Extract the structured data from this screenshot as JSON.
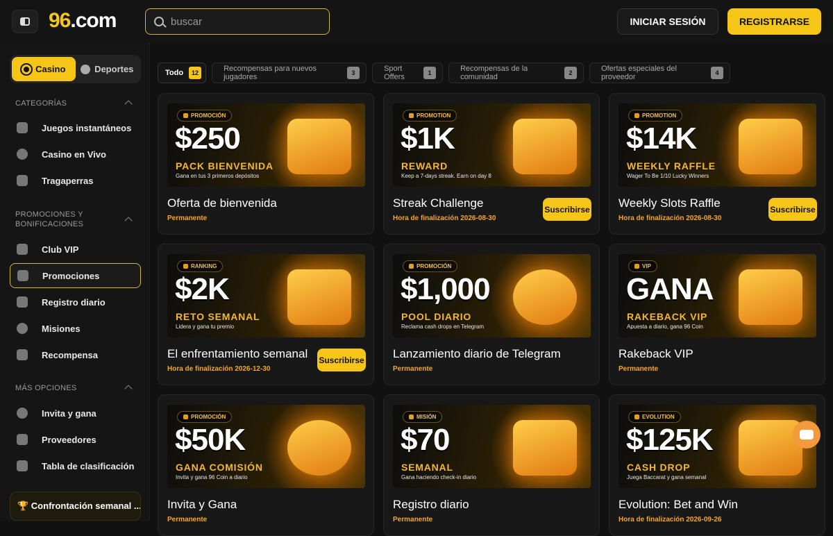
{
  "header": {
    "logo_num": "96",
    "logo_domain": ".com",
    "search_placeholder": "buscar",
    "login_label": "INICIAR SESIÓN",
    "register_label": "REGISTRARSE"
  },
  "sidebar": {
    "switch": {
      "casino": "Casino",
      "sports": "Deportes"
    },
    "categories_heading": "CATEGORÍAS",
    "categories": [
      {
        "label": "Juegos instantáneos",
        "icon": "rocket-icon"
      },
      {
        "label": "Casino en Vivo",
        "icon": "live-casino-icon"
      },
      {
        "label": "Tragaperras",
        "icon": "seven-icon"
      }
    ],
    "promos_heading": "PROMOCIONES Y BONIFICACIONES",
    "promos": [
      {
        "label": "Club VIP",
        "icon": "crown-icon"
      },
      {
        "label": "Promociones",
        "icon": "promo-icon"
      },
      {
        "label": "Registro diario",
        "icon": "calendar-icon"
      },
      {
        "label": "Misiones",
        "icon": "target-icon"
      },
      {
        "label": "Recompensa",
        "icon": "gift-icon"
      }
    ],
    "more_heading": "MÁS OPCIONES",
    "more": [
      {
        "label": "Invita y gana",
        "icon": "invite-icon"
      },
      {
        "label": "Proveedores",
        "icon": "gamepad-icon"
      },
      {
        "label": "Tabla de clasificación",
        "icon": "trophy-icon"
      }
    ],
    "bottom_card": "🏆 Confrontación semanal ..."
  },
  "filters": [
    {
      "label": "Todo",
      "count": "12"
    },
    {
      "label": "Recompensas para nuevos jugadores",
      "count": "3"
    },
    {
      "label": "Sport Offers",
      "count": "1"
    },
    {
      "label": "Recompensas de la comunidad",
      "count": "2"
    },
    {
      "label": "Ofertas especiales del proveedor",
      "count": "4"
    }
  ],
  "cards": [
    {
      "tag": "PROMOCIÓN",
      "big": "$250",
      "sub": "PACK BIENVENIDA",
      "tiny": "Gana en tus 3 primeros depósitos",
      "title": "Oferta de bienvenida",
      "status": "Permanente",
      "button": ""
    },
    {
      "tag": "PROMOTION",
      "big": "$1K",
      "sub": "REWARD",
      "tiny": "Keep a 7-days streak. Earn on day 8",
      "title": "Streak Challenge",
      "status": "Hora de finalización 2026-08-30",
      "button": "Suscribirse"
    },
    {
      "tag": "PROMOTION",
      "big": "$14K",
      "sub": "WEEKLY RAFFLE",
      "tiny": "Wager To Be 1/10 Lucky Winners",
      "title": "Weekly Slots Raffle",
      "status": "Hora de finalización 2026-08-30",
      "button": "Suscribirse"
    },
    {
      "tag": "RANKING",
      "big": "$2K",
      "sub": "RETO SEMANAL",
      "tiny": "Lidera y gana tu premio",
      "title": "El enfrentamiento semanal",
      "status": "Hora de finalización 2026-12-30",
      "button": "Suscribirse"
    },
    {
      "tag": "PROMOCIÓN",
      "big": "$1,000",
      "sub": "POOL DIARIO",
      "tiny": "Reclama cash drops en Telegram",
      "title": "Lanzamiento diario de Telegram",
      "status": "Permanente",
      "button": ""
    },
    {
      "tag": "VIP",
      "big": "GANA",
      "sub": "RAKEBACK VIP",
      "tiny": "Apuesta a diario, gana 96 Coin",
      "title": "Rakeback VIP",
      "status": "Permanente",
      "button": ""
    },
    {
      "tag": "PROMOCIÓN",
      "big": "$50K",
      "sub": "GANA COMISIÓN",
      "tiny": "Invita y gana 96 Coin a diario",
      "title": "Invita y Gana",
      "status": "Permanente",
      "button": ""
    },
    {
      "tag": "MISIÓN",
      "big": "$70",
      "sub": "SEMANAL",
      "tiny": "Gana haciendo check-in diario",
      "title": "Registro diario",
      "status": "Permanente",
      "button": ""
    },
    {
      "tag": "EVOLUTION",
      "big": "$125K",
      "sub": "CASH DROP",
      "tiny": "Juega Baccarat y gana semanal",
      "title": "Evolution: Bet and Win",
      "status": "Hora de finalización 2026-09-26",
      "button": ""
    }
  ]
}
